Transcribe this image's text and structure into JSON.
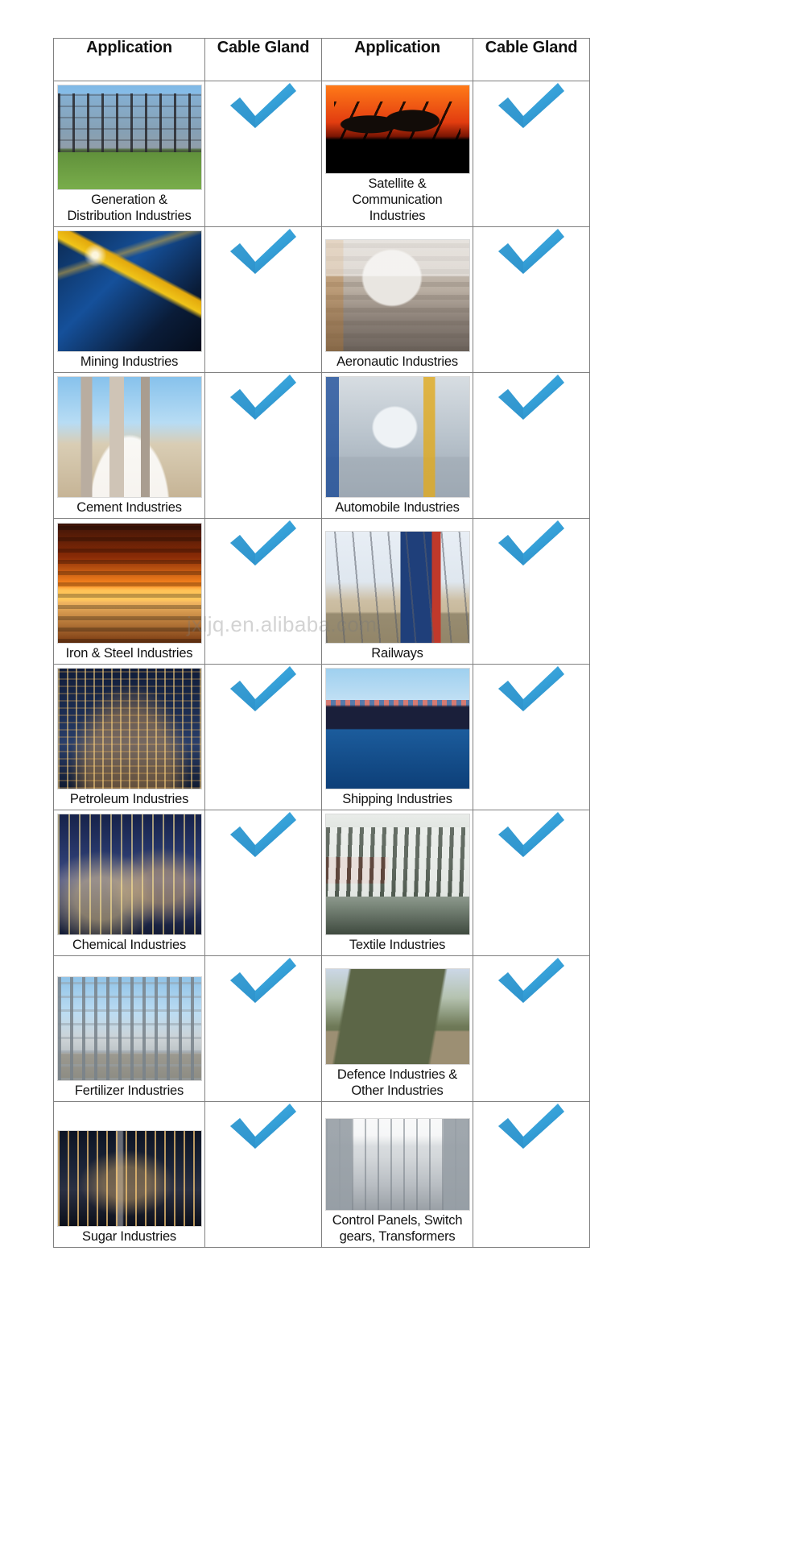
{
  "table": {
    "headers": [
      "Application",
      "Cable Gland",
      "Application",
      "Cable Gland"
    ],
    "check_icon_name": "blue-check-mark-icon",
    "check_color": "#3BA3DC",
    "check_color_dark": "#2C86BE",
    "border_color": "#808080",
    "rows": [
      {
        "left": {
          "label": "Generation &\nDistribution Industries",
          "image": "electrical-substation-photo",
          "gland": "check"
        },
        "right": {
          "label": "Satellite &\nCommunication Industries",
          "image": "satellite-dishes-sunset-photo",
          "gland": "check"
        }
      },
      {
        "left": {
          "label": "Mining Industries",
          "image": "mining-excavator-night-photo",
          "gland": "check"
        },
        "right": {
          "label": "Aeronautic Industries",
          "image": "aircraft-hangar-photo",
          "gland": "check"
        }
      },
      {
        "left": {
          "label": "Cement Industries",
          "image": "cement-plant-photo",
          "gland": "check"
        },
        "right": {
          "label": "Automobile Industries",
          "image": "car-assembly-line-photo",
          "gland": "check"
        }
      },
      {
        "left": {
          "label": "Iron & Steel Industries",
          "image": "molten-steel-mill-photo",
          "gland": "check"
        },
        "right": {
          "label": "Railways",
          "image": "railway-locomotive-photo",
          "gland": "check"
        }
      },
      {
        "left": {
          "label": "Petroleum Industries",
          "image": "petroleum-refinery-night-photo",
          "gland": "check"
        },
        "right": {
          "label": "Shipping Industries",
          "image": "container-ship-port-photo",
          "gland": "check"
        }
      },
      {
        "left": {
          "label": "Chemical Industries",
          "image": "chemical-plant-night-photo",
          "gland": "check"
        },
        "right": {
          "label": "Textile Industries",
          "image": "textile-spinning-machine-photo",
          "gland": "check"
        }
      },
      {
        "left": {
          "label": "Fertilizer Industries",
          "image": "fertilizer-plant-photo",
          "gland": "check"
        },
        "right": {
          "label": "Defence Industries &\nOther Industries",
          "image": "military-missile-launcher-photo",
          "gland": "check"
        }
      },
      {
        "left": {
          "label": "Sugar Industries",
          "image": "sugar-mill-night-photo",
          "gland": "check"
        },
        "right": {
          "label": "Control Panels, Switch\ngears, Transformers",
          "image": "control-panel-room-photo",
          "gland": "check"
        }
      }
    ]
  },
  "watermark": {
    "text": "jxljq.en.alibaba.com"
  }
}
